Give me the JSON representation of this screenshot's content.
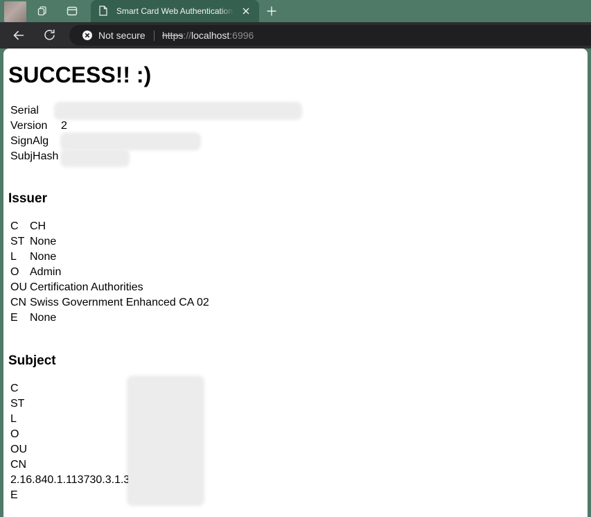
{
  "browser": {
    "tab_title": "Smart Card Web Authentication Te",
    "security_label": "Not secure",
    "url": {
      "scheme": "https",
      "separator": "://",
      "host": "localhost",
      "port": ":6996"
    }
  },
  "page": {
    "heading": "SUCCESS!! :)",
    "certificate": [
      {
        "key": "Serial",
        "value": ""
      },
      {
        "key": "Version",
        "value": "2"
      },
      {
        "key": "SignAlg",
        "value": ""
      },
      {
        "key": "SubjHash",
        "value": ""
      }
    ],
    "issuer": {
      "heading": "Issuer",
      "rows": [
        {
          "key": "C",
          "value": "CH"
        },
        {
          "key": "ST",
          "value": "None"
        },
        {
          "key": "L",
          "value": "None"
        },
        {
          "key": "O",
          "value": "Admin"
        },
        {
          "key": "OU",
          "value": "Certification Authorities"
        },
        {
          "key": "CN",
          "value": "Swiss Government Enhanced CA 02"
        },
        {
          "key": "E",
          "value": "None"
        }
      ]
    },
    "subject": {
      "heading": "Subject",
      "rows": [
        {
          "key": "C",
          "value": ""
        },
        {
          "key": "ST",
          "value": ""
        },
        {
          "key": "L",
          "value": ""
        },
        {
          "key": "O",
          "value": ""
        },
        {
          "key": "OU",
          "value": ""
        },
        {
          "key": "CN",
          "value": ""
        },
        {
          "key": "2.16.840.1.113730.3.1.3",
          "value": ""
        },
        {
          "key": "E",
          "value": ""
        }
      ]
    }
  }
}
